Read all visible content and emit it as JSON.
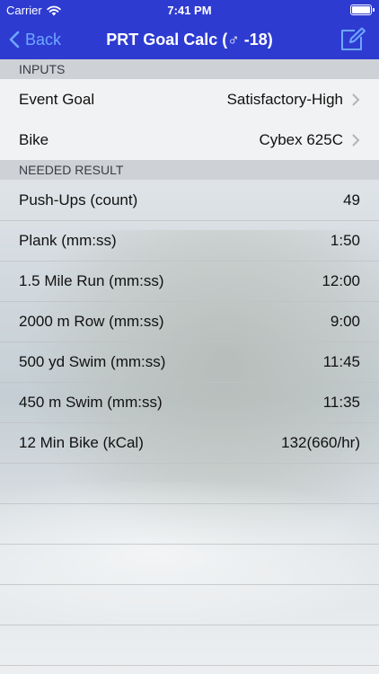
{
  "status": {
    "carrier": "Carrier",
    "time": "7:41 PM"
  },
  "nav": {
    "back_label": "Back",
    "title": "PRT Goal Calc (♂ -18)"
  },
  "inputs": {
    "header": "INPUTS",
    "rows": [
      {
        "label": "Event Goal",
        "value": "Satisfactory-High"
      },
      {
        "label": "Bike",
        "value": "Cybex 625C"
      }
    ]
  },
  "results": {
    "header": "NEEDED RESULT",
    "rows": [
      {
        "label": "Push-Ups (count)",
        "value": "49"
      },
      {
        "label": "Plank (mm:ss)",
        "value": "1:50"
      },
      {
        "label": "1.5 Mile Run (mm:ss)",
        "value": "12:00"
      },
      {
        "label": "2000 m Row (mm:ss)",
        "value": "9:00"
      },
      {
        "label": "500 yd Swim (mm:ss)",
        "value": "11:45"
      },
      {
        "label": "450 m Swim (mm:ss)",
        "value": "11:35"
      },
      {
        "label": "12 Min Bike (kCal)",
        "value": "132(660/hr)"
      }
    ]
  },
  "colors": {
    "nav_bg": "#2e3bd1",
    "back_tint": "#6fa7ff"
  },
  "icons": {
    "wifi": "wifi-icon",
    "battery": "battery-icon",
    "back": "chevron-left-icon",
    "compose": "compose-icon",
    "disclosure": "chevron-right-icon"
  }
}
